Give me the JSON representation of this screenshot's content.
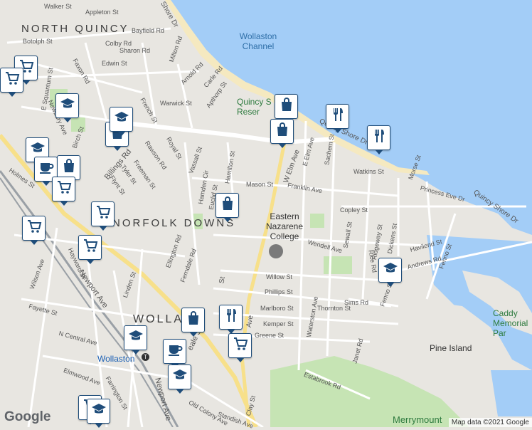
{
  "map": {
    "colors": {
      "water": "#a3cdf7",
      "land": "#e8e6e1",
      "road": "#ffffff",
      "major_road": "#f7e08a",
      "park": "#c6e4b4",
      "rail": "#9aa0a6",
      "pin_border": "#1f4d7a"
    },
    "area_labels": {
      "north_quincy": "NORTH QUINCY",
      "norfolk_downs": "NORFOLK DOWNS",
      "wollaston": "WOLLA",
      "wollaston_channel": "Wollaston Channel",
      "quincy_reservation": "Quincy S Reser",
      "eastern_nazarene": "Eastern Nazarene College",
      "caddy_park": "Caddy Memorial Par",
      "pine_island": "Pine Island",
      "merrymount": "Merrymount",
      "wollaston_station": "Wollaston"
    },
    "streets": {
      "walker": "Walker St",
      "appleton": "Appleton St",
      "bayfield": "Bayfield Rd",
      "botolph": "Botolph St",
      "colby": "Colby Rd",
      "sharon": "Sharon Rd",
      "milton": "Milton Rd",
      "faxon": "Faxon Rd",
      "edwin": "Edwin St",
      "arnold": "Arnold Rd",
      "carle": "Carle Rd",
      "apthorp": "Apthorp St",
      "warwick": "Warwick St",
      "french": "French St",
      "newbury": "Newbury Ave",
      "quantum": "E Squantum St",
      "birch": "Birch St",
      "hollis": "Hollis Ave",
      "holmes": "Holmes St",
      "royal": "Royal St",
      "rawson": "Rawson Rd",
      "billings": "Billings Rd",
      "freeman": "Freeman St",
      "tyler": "Tyler St",
      "flynt": "Flynt St",
      "vassall": "Vassall St",
      "hamilton": "Hamilton St",
      "hamden": "Hamden Cir",
      "mason": "Mason St",
      "franklin": "Franklin Ave",
      "elm": "W Elm Ave",
      "eelm": "E Elm Ave",
      "sachem": "Sachem St",
      "watkins": "Watkins St",
      "morse": "Morse St",
      "shore_dr": "Quincy Shore Dr",
      "shore_dr2": "Quincy Shore Dr",
      "shore_top": "Shore Dr",
      "princess": "Princess Eve Dr",
      "copley": "Copley St",
      "wendell": "Wendell Ave",
      "sewall": "Sewall St",
      "ridgeway": "Ridgeway St",
      "dickens": "Dickens St",
      "havilend": "Havilend St",
      "andrews": "Andrews Rd",
      "fenno": "Fenno St",
      "fenno2": "Fenno St",
      "rice": "Rice Rd",
      "willow": "Willow St",
      "phillips": "Phillips St",
      "sims": "Sims Rd",
      "thornton": "Thornton St",
      "marlboro": "Marlboro St",
      "kemper": "Kemper St",
      "greene": "Greene St",
      "waterston": "Waterston Ave",
      "janet": "Janet Rd",
      "estabrook": "Estabrook Rd",
      "ellington": "Ellington Rd",
      "ferndale": "Ferndale Rd",
      "linden": "Linden St",
      "hayward": "Hayward St",
      "wilson": "Wilson Ave",
      "newport": "Newport Ave",
      "newport2": "Newport Ave",
      "ncentral": "N Central Ave",
      "fayette": "Fayette St",
      "elmwood": "Elmwood Ave",
      "farrington": "Farrington St",
      "oldcolony": "Old Colony Ave",
      "standish": "Standish Ave",
      "clay": "Clay St",
      "beale": "eale St",
      "ave": "Ave",
      "hancock_st": "St",
      "euclid": "Euclid St"
    },
    "pins": [
      {
        "icon": "cart-icon"
      },
      {
        "icon": "cart-icon"
      },
      {
        "icon": "school-icon"
      },
      {
        "icon": "school-icon"
      },
      {
        "icon": "bag-icon"
      },
      {
        "icon": "bag-icon"
      },
      {
        "icon": "restaurant-icon"
      },
      {
        "icon": "restaurant-icon"
      },
      {
        "icon": "school-icon"
      },
      {
        "icon": "cafe-icon"
      },
      {
        "icon": "bag-icon"
      },
      {
        "icon": "cart-icon"
      },
      {
        "icon": "cart-icon"
      },
      {
        "icon": "cart-icon"
      },
      {
        "icon": "cart-icon"
      },
      {
        "icon": "bag-icon"
      },
      {
        "icon": "school-icon"
      },
      {
        "icon": "bag-icon"
      },
      {
        "icon": "restaurant-icon"
      },
      {
        "icon": "cart-icon"
      },
      {
        "icon": "bag-icon"
      },
      {
        "icon": "cafe-icon"
      },
      {
        "icon": "school-icon"
      },
      {
        "icon": "school-icon"
      },
      {
        "icon": "cart-icon"
      },
      {
        "icon": "school-icon"
      }
    ],
    "google_logo": "Google",
    "attribution": "Map data ©2021 Google"
  }
}
